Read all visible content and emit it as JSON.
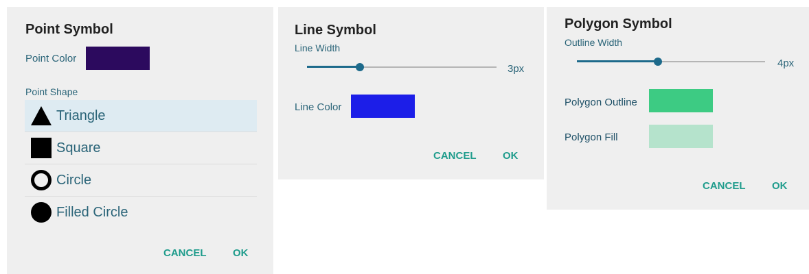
{
  "point": {
    "title": "Point Symbol",
    "color_label": "Point Color",
    "color": "#2c0a5e",
    "shape_label": "Point Shape",
    "shapes": [
      {
        "label": "Triangle",
        "icon": "triangle-icon",
        "selected": true
      },
      {
        "label": "Square",
        "icon": "square-icon",
        "selected": false
      },
      {
        "label": "Circle",
        "icon": "circle-outline-icon",
        "selected": false
      },
      {
        "label": "Filled Circle",
        "icon": "filled-circle-icon",
        "selected": false
      }
    ],
    "cancel": "CANCEL",
    "ok": "OK"
  },
  "line": {
    "title": "Line Symbol",
    "width_label": "Line Width",
    "width_value": "3px",
    "width_fraction": 0.28,
    "color_label": "Line Color",
    "color": "#1c1ee8",
    "cancel": "CANCEL",
    "ok": "OK"
  },
  "polygon": {
    "title": "Polygon Symbol",
    "width_label": "Outline Width",
    "width_value": "4px",
    "width_fraction": 0.43,
    "outline_label": "Polygon Outline",
    "outline_color": "#3dcb83",
    "fill_label": "Polygon Fill",
    "fill_color": "#b5e3cc",
    "cancel": "CANCEL",
    "ok": "OK"
  },
  "colors": {
    "accent": "#1d6a8b",
    "button": "#1f9c8c",
    "label": "#2a6478",
    "dialog_bg": "#efefef",
    "selected_row": "#deebf2"
  }
}
